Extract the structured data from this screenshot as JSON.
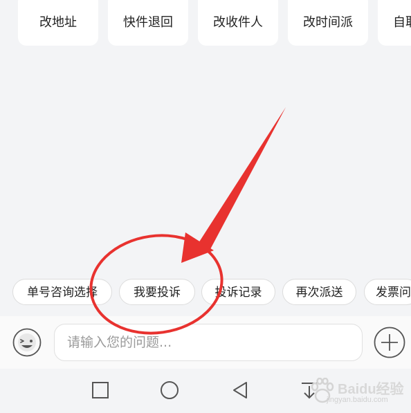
{
  "services": [
    {
      "label": "改地址",
      "icon": "address-icon"
    },
    {
      "label": "快件退回",
      "icon": "return-icon"
    },
    {
      "label": "改收件人",
      "icon": "recipient-icon"
    },
    {
      "label": "改时间派",
      "icon": "schedule-icon"
    },
    {
      "label": "自取",
      "icon": "pickup-icon"
    }
  ],
  "quick_replies": [
    {
      "label": "单号咨询选择"
    },
    {
      "label": "我要投诉"
    },
    {
      "label": "投诉记录"
    },
    {
      "label": "再次派送"
    },
    {
      "label": "发票问"
    }
  ],
  "input": {
    "placeholder": "请输入您的问题...",
    "emoji_icon": "emoji-icon",
    "plus_icon": "plus-icon"
  },
  "nav": {
    "recent_icon": "square-icon",
    "home_icon": "circle-icon",
    "back_icon": "triangle-back-icon",
    "menu_icon": "download-icon"
  },
  "watermark": {
    "brand": "Baidu经验",
    "url": "jingyan.baidu.com"
  },
  "annotation_color": "#e8322f"
}
